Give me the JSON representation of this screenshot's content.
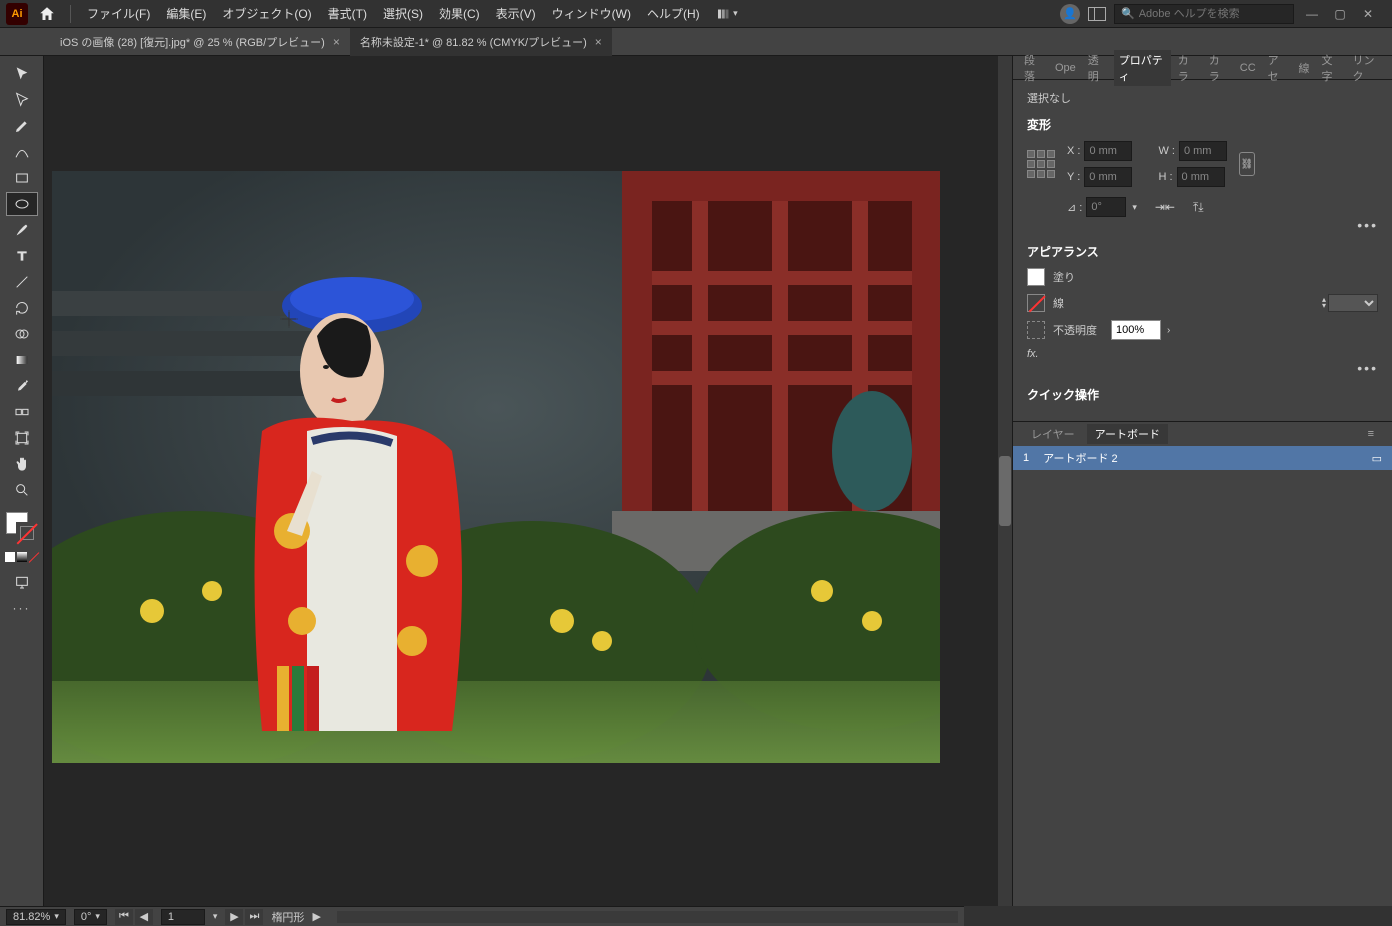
{
  "menubar": {
    "items": [
      "ファイル(F)",
      "編集(E)",
      "オブジェクト(O)",
      "書式(T)",
      "選択(S)",
      "効果(C)",
      "表示(V)",
      "ウィンドウ(W)",
      "ヘルプ(H)"
    ],
    "search_placeholder": "Adobe ヘルプを検索"
  },
  "tabs": [
    {
      "label": "iOS の画像 (28) [復元].jpg* @ 25 % (RGB/プレビュー)",
      "active": false
    },
    {
      "label": "名称未設定-1* @ 81.82 % (CMYK/プレビュー)",
      "active": true
    }
  ],
  "panel_tab_strip": [
    "段落",
    "Ope",
    "透明",
    "プロパティ",
    "カラ",
    "カラ",
    "CC",
    "アセ",
    "線",
    "文字",
    "リンク"
  ],
  "panel_tab_active_index": 3,
  "properties": {
    "selection_label": "選択なし",
    "transform_label": "変形",
    "x_label": "X :",
    "y_label": "Y :",
    "w_label": "W :",
    "h_label": "H :",
    "x": "0 mm",
    "y": "0 mm",
    "w": "0 mm",
    "h": "0 mm",
    "angle_label": "⊿ :",
    "angle": "0°",
    "appearance_label": "アピアランス",
    "fill_label": "塗り",
    "stroke_label": "線",
    "opacity_label": "不透明度",
    "opacity": "100%",
    "fx_label": "fx.",
    "quick_label": "クイック操作"
  },
  "artboard_panel": {
    "tabs": [
      "レイヤー",
      "アートボード"
    ],
    "active_tab": 1,
    "row_index": "1",
    "row_name": "アートボード 2"
  },
  "statusbar": {
    "zoom": "81.82%",
    "angle": "0°",
    "page": "1",
    "tool": "楕円形"
  }
}
